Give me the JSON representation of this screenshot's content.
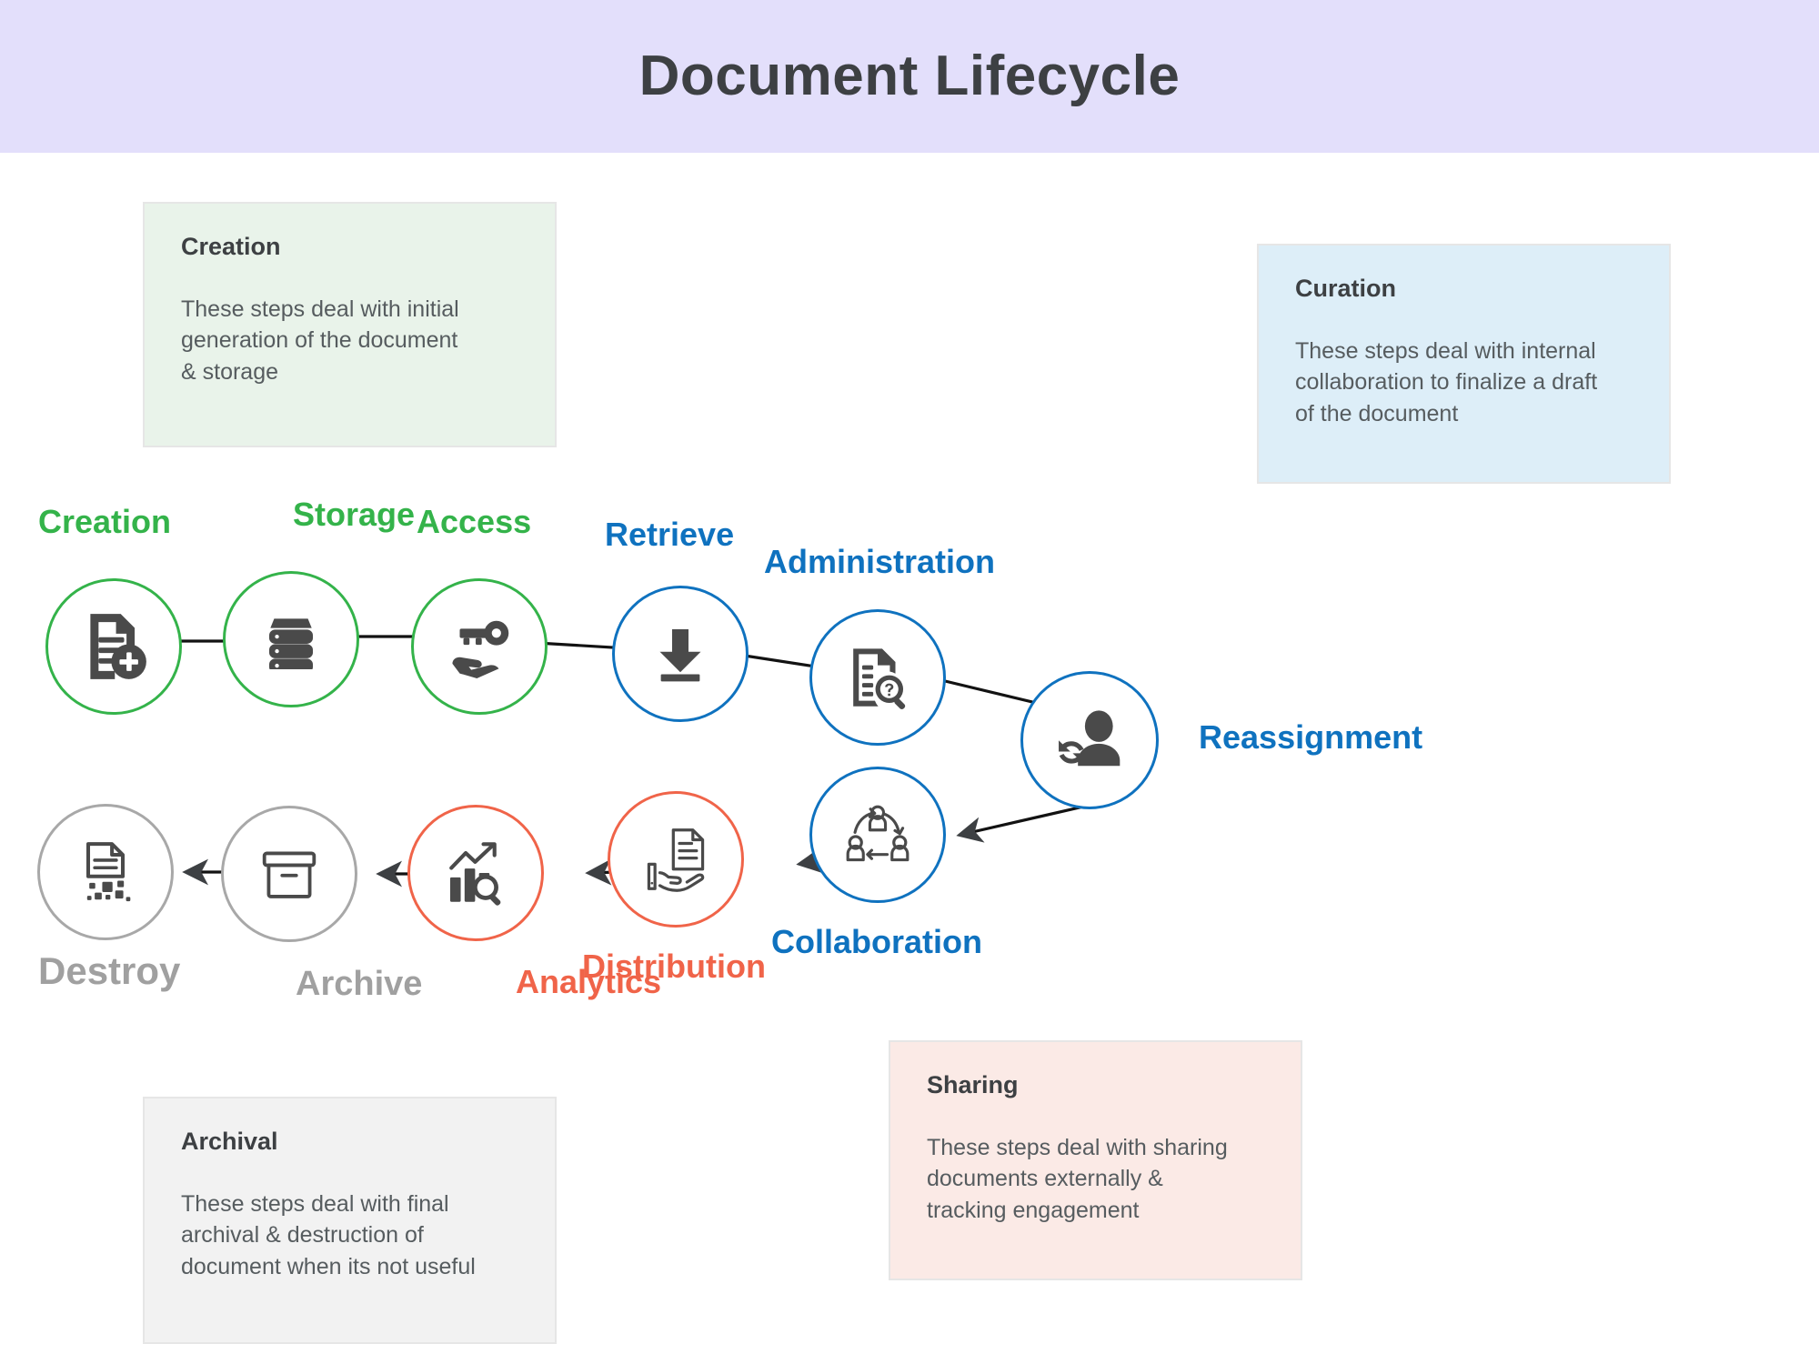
{
  "header": {
    "title": "Document Lifecycle",
    "background_color": "#e3dffb",
    "text_color": "#3d4043"
  },
  "colors": {
    "creation_green": "#34b34a",
    "curation_blue": "#0f72bf",
    "sharing_coral": "#f06449",
    "archival_gray": "#a0a0a0",
    "icon_gray": "#4a4a4a",
    "arrow_black": "#1a1a1a"
  },
  "legends": [
    {
      "key": "creation",
      "title": "Creation",
      "body": "These steps deal with initial\ngeneration of the document\n& storage",
      "background_color": "#e9f3ea"
    },
    {
      "key": "curation",
      "title": "Curation",
      "body": "These steps deal with internal\ncollaboration to finalize a draft\nof the document",
      "background_color": "#ddeef8"
    },
    {
      "key": "archival",
      "title": "Archival",
      "body": "These steps deal with final\narchival & destruction of\ndocument when its not useful",
      "background_color": "#f2f2f2"
    },
    {
      "key": "sharing",
      "title": "Sharing",
      "body": "These steps deal with sharing\ndocuments externally &\ntracking engagement",
      "background_color": "#fbeae6"
    }
  ],
  "flow": {
    "nodes": [
      {
        "key": "creation",
        "label": "Creation",
        "group": "creation",
        "color": "#34b34a",
        "icon": "document-plus-icon"
      },
      {
        "key": "storage",
        "label": "Storage",
        "group": "creation",
        "color": "#34b34a",
        "icon": "server-stack-icon"
      },
      {
        "key": "access",
        "label": "Access",
        "group": "creation",
        "color": "#34b34a",
        "icon": "hand-key-icon"
      },
      {
        "key": "retrieve",
        "label": "Retrieve",
        "group": "curation",
        "color": "#0f72bf",
        "icon": "download-arrow-icon"
      },
      {
        "key": "administration",
        "label": "Administration",
        "group": "curation",
        "color": "#0f72bf",
        "icon": "document-magnifier-icon"
      },
      {
        "key": "reassignment",
        "label": "Reassignment",
        "group": "curation",
        "color": "#0f72bf",
        "icon": "person-sync-icon"
      },
      {
        "key": "collaboration",
        "label": "Collaboration",
        "group": "curation",
        "color": "#0f72bf",
        "icon": "people-cycle-icon"
      },
      {
        "key": "distribution",
        "label": "Distribution",
        "group": "sharing",
        "color": "#f06449",
        "icon": "hand-document-icon"
      },
      {
        "key": "analytics",
        "label": "Analytics",
        "group": "sharing",
        "color": "#f06449",
        "icon": "chart-magnifier-icon"
      },
      {
        "key": "archive",
        "label": "Archive",
        "group": "archival",
        "color": "#a0a0a0",
        "icon": "archive-box-icon"
      },
      {
        "key": "destroy",
        "label": "Destroy",
        "group": "archival",
        "color": "#a0a0a0",
        "icon": "shredded-document-icon"
      }
    ],
    "sequence": [
      "creation",
      "storage",
      "access",
      "retrieve",
      "administration",
      "reassignment",
      "collaboration",
      "distribution",
      "analytics",
      "archive",
      "destroy"
    ]
  }
}
